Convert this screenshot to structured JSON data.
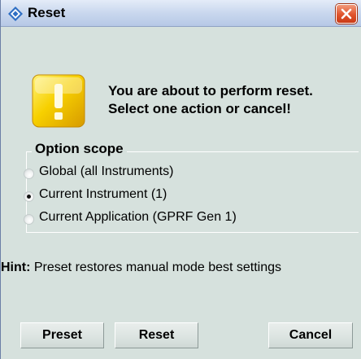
{
  "window": {
    "title": "Reset",
    "icon": "rohde-schwarz-diamond-icon",
    "close_icon": "close-x-icon"
  },
  "message": {
    "icon": "warning-exclamation-icon",
    "line1": "You are about to perform reset.",
    "line2": "Select one action or cancel!"
  },
  "option_scope": {
    "legend": "Option scope",
    "selected_index": 1,
    "options": [
      {
        "label": "Global (all Instruments)",
        "selected": false
      },
      {
        "label": "Current Instrument (1)",
        "selected": true
      },
      {
        "label": "Current Application (GPRF Gen 1)",
        "selected": false
      }
    ]
  },
  "hint": {
    "label": "Hint:",
    "text": " Preset restores manual mode best settings"
  },
  "buttons": {
    "preset": "Preset",
    "reset": "Reset",
    "cancel": "Cancel"
  },
  "colors": {
    "dialog_background": "#d6e1dd",
    "titlebar": "#c9d7ee",
    "close_button": "#e0532c",
    "warning_icon": "#f5c400"
  }
}
